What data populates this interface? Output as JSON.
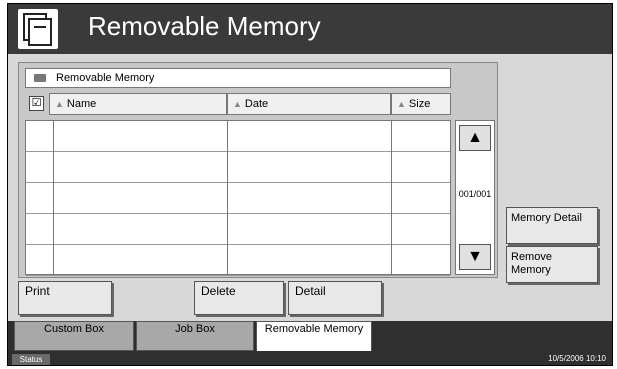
{
  "header": {
    "title": "Removable Memory",
    "icon": "document-box-icon"
  },
  "panel": {
    "path": "Removable Memory",
    "columns": [
      {
        "label": "Name"
      },
      {
        "label": "Date"
      },
      {
        "label": "Size"
      }
    ],
    "page_indicator": "001/001"
  },
  "side_buttons": {
    "memory_detail": "Memory Detail",
    "remove_memory": "Remove Memory"
  },
  "actions": {
    "print": "Print",
    "delete": "Delete",
    "detail": "Detail"
  },
  "tabs": [
    {
      "label": "Custom Box",
      "active": false
    },
    {
      "label": "Job Box",
      "active": false
    },
    {
      "label": "Removable Memory",
      "active": true
    }
  ],
  "status": {
    "status_label": "Status",
    "datetime": "10/5/2006   10:10"
  }
}
